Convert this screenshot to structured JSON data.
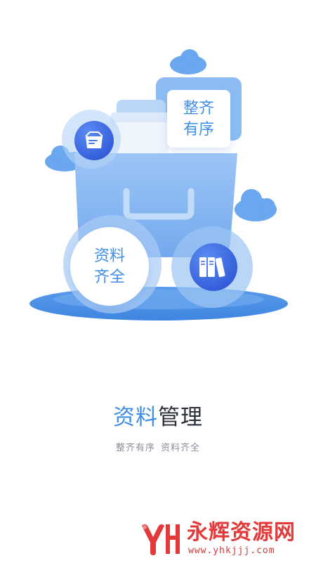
{
  "illustration": {
    "tag_top": [
      "整齐",
      "有序"
    ],
    "tag_bottom": [
      "资料",
      "齐全"
    ]
  },
  "title": {
    "accent": "资料",
    "rest": "管理"
  },
  "subtitle": {
    "part1": "整齐有序",
    "part2": "资料齐全"
  },
  "watermark": {
    "name": "永辉资源网",
    "url": "www.yhkjjj.com"
  },
  "colors": {
    "accent": "#3f8ee6",
    "title_dark": "#2a2f3a",
    "watermark": "#e23a3a"
  }
}
